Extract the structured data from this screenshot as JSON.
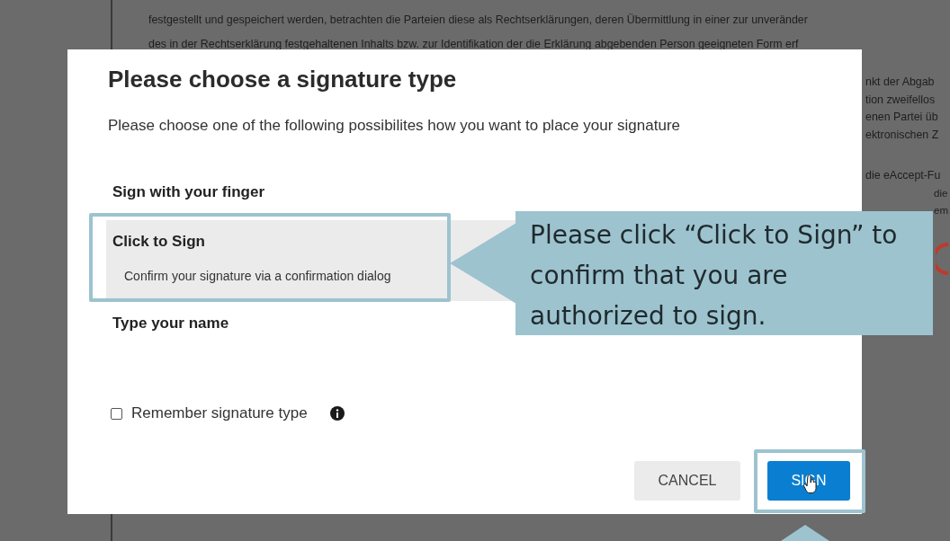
{
  "document": {
    "lines": [
      "festgestellt und gespeichert werden, betrachten die Parteien diese als Rechtserklärungen, deren Übermittlung in einer zur unveränder",
      "des in der Rechtserklärung festgehaltenen Inhalts bzw. zur Identifikation der die Erklärung abgebenden Person geeigneten Form erf"
    ],
    "side_lines": [
      "nkt der Abgab",
      "tion zweifellos",
      "enen Partei üb",
      "ektronischen Z"
    ],
    "lower_lines": [
      "die eAccept-Fu"
    ],
    "edge_lines": [
      "die",
      "em"
    ]
  },
  "dialog": {
    "title": "Please choose a signature type",
    "subtitle": "Please choose one of the following possibilites how you want to place your signature",
    "options": [
      {
        "label": "Sign with your finger",
        "selected": false
      },
      {
        "label": "Click to Sign",
        "description": "Confirm your signature via a confirmation dialog",
        "selected": true
      },
      {
        "label": "Type your name",
        "selected": false
      }
    ],
    "remember": {
      "label": "Remember signature type",
      "checked": false
    },
    "buttons": [
      {
        "label": "CANCEL",
        "kind": "secondary"
      },
      {
        "label": "SIGN",
        "kind": "primary"
      }
    ]
  },
  "tutorial": {
    "text": "Please click “Click to Sign” to confirm that you are authorized to sign."
  }
}
